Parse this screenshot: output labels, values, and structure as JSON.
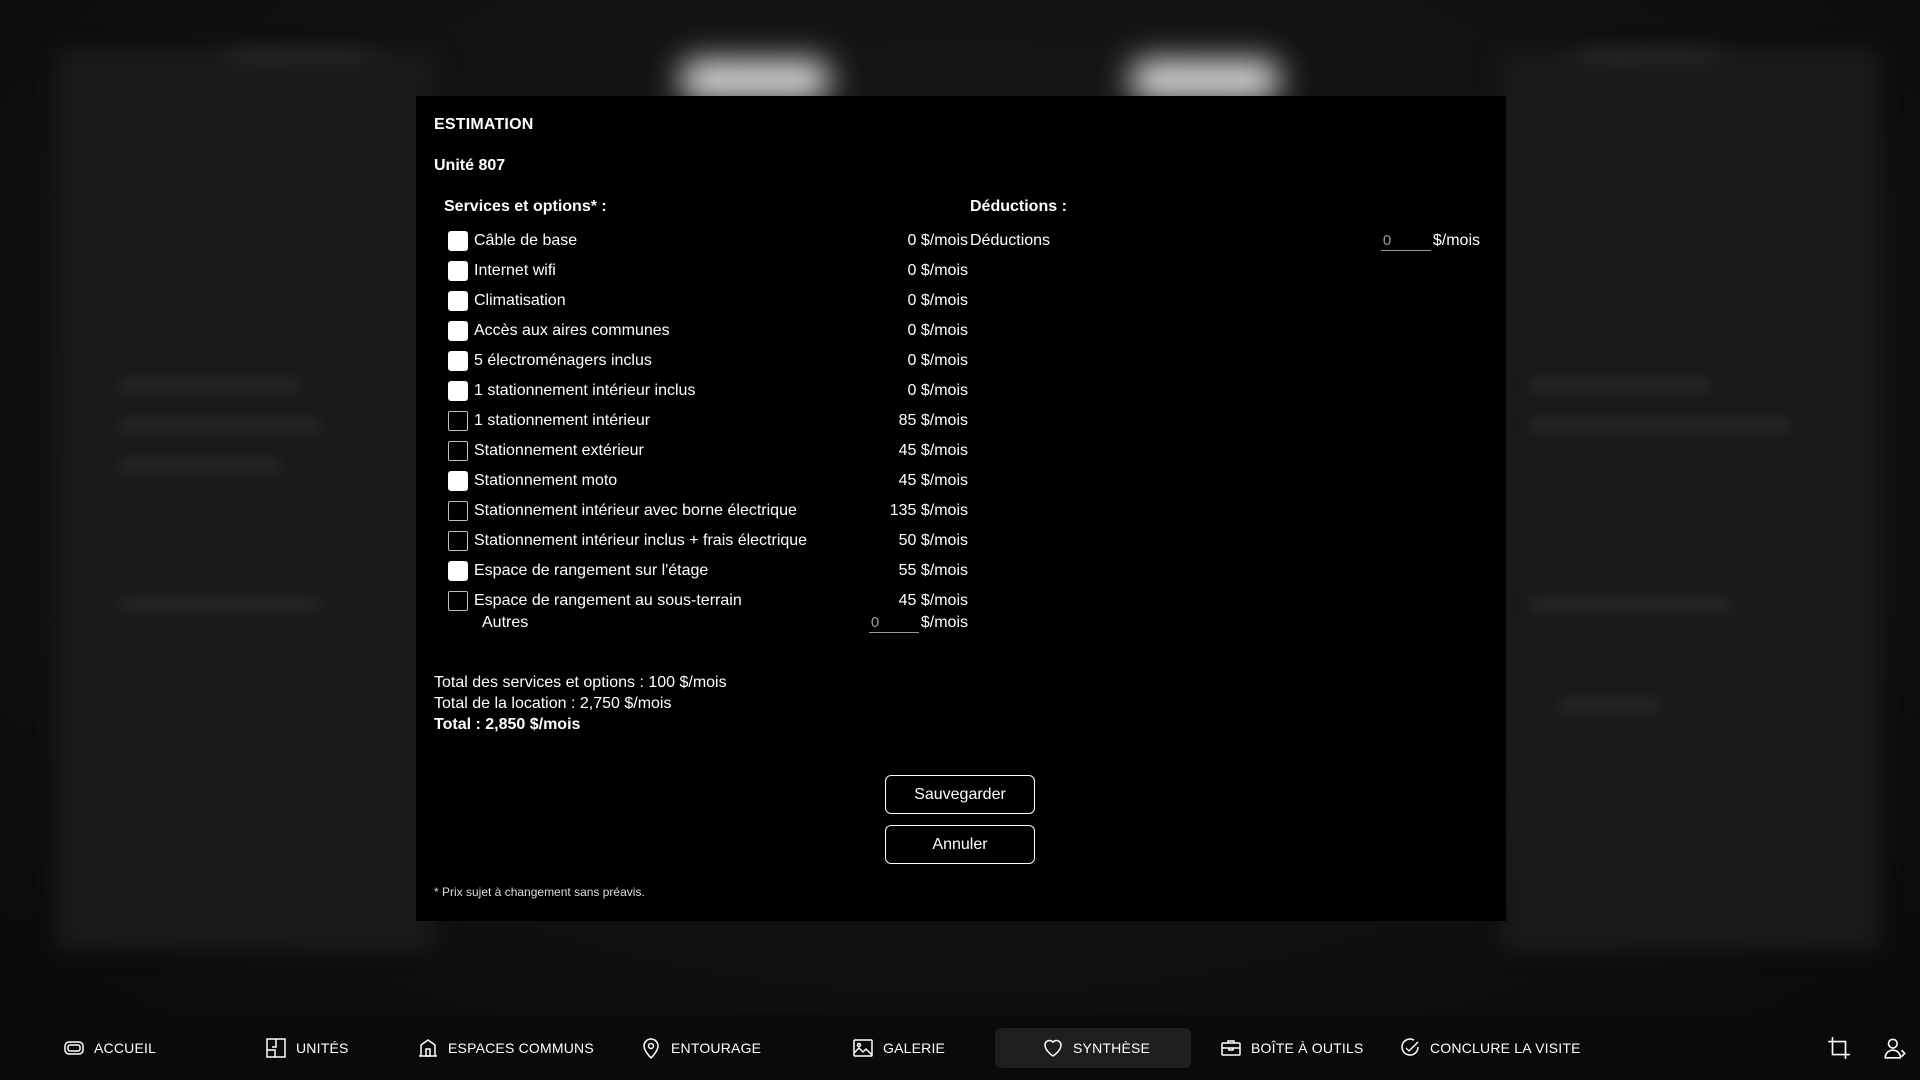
{
  "modal": {
    "title": "ESTIMATION",
    "unit": "Unité 807",
    "services_heading": "Services et options* :",
    "deductions_heading": "Déductions :",
    "services": [
      {
        "label": "Câble de base",
        "price": "0 $/mois",
        "checked": true
      },
      {
        "label": "Internet wifi",
        "price": "0 $/mois",
        "checked": true
      },
      {
        "label": "Climatisation",
        "price": "0 $/mois",
        "checked": true
      },
      {
        "label": "Accès aux aires communes",
        "price": "0 $/mois",
        "checked": true
      },
      {
        "label": "5 électroménagers inclus",
        "price": "0 $/mois",
        "checked": true
      },
      {
        "label": "1 stationnement intérieur inclus",
        "price": "0 $/mois",
        "checked": true
      },
      {
        "label": "1 stationnement intérieur",
        "price": "85 $/mois",
        "checked": false
      },
      {
        "label": "Stationnement extérieur",
        "price": "45 $/mois",
        "checked": false
      },
      {
        "label": "Stationnement moto",
        "price": "45 $/mois",
        "checked": true
      },
      {
        "label": "Stationnement intérieur avec borne électrique",
        "price": "135 $/mois",
        "checked": false
      },
      {
        "label": "Stationnement intérieur inclus + frais électrique",
        "price": "50 $/mois",
        "checked": false
      },
      {
        "label": "Espace de rangement sur l'étage",
        "price": "55 $/mois",
        "checked": true
      },
      {
        "label": "Espace de rangement au sous-terrain",
        "price": "45 $/mois",
        "checked": false
      }
    ],
    "autres": {
      "label": "Autres",
      "value": "0",
      "suffix": "$/mois"
    },
    "deduction": {
      "label": "Déductions",
      "value": "0",
      "suffix": "$/mois"
    },
    "totals": {
      "services": "Total des services et options : 100 $/mois",
      "location": "Total de la location : 2,750 $/mois",
      "grand": "Total : 2,850 $/mois"
    },
    "save_label": "Sauvegarder",
    "cancel_label": "Annuler",
    "footnote": "* Prix sujet à changement sans préavis."
  },
  "nav": {
    "items": [
      {
        "label": "ACCUEIL",
        "icon": "home-icon"
      },
      {
        "label": "UNITÉS",
        "icon": "floorplan-icon"
      },
      {
        "label": "ESPACES COMMUNS",
        "icon": "building-icon"
      },
      {
        "label": "ENTOURAGE",
        "icon": "location-pin-icon"
      },
      {
        "label": "GALERIE",
        "icon": "image-icon"
      },
      {
        "label": "SYNTHÈSE",
        "icon": "heart-icon",
        "active": true
      },
      {
        "label": "BOÎTE À OUTILS",
        "icon": "toolbox-icon"
      },
      {
        "label": "CONCLURE LA VISITE",
        "icon": "check-circle-icon"
      }
    ],
    "right_icons": [
      "crop-icon",
      "user-icon"
    ]
  }
}
